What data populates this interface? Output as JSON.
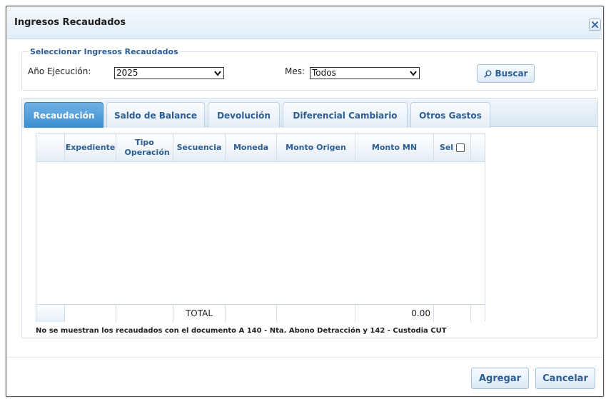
{
  "dialog": {
    "title": "Ingresos Recaudados",
    "close_icon": "close-icon"
  },
  "filter": {
    "legend": "Seleccionar Ingresos Recaudados",
    "year_label": "Año Ejecución:",
    "year_value": "2025",
    "month_label": "Mes:",
    "month_value": "Todos",
    "search_label": "Buscar",
    "search_icon": "search-icon"
  },
  "tabs": [
    {
      "label": "Recaudación",
      "active": true
    },
    {
      "label": "Saldo de Balance",
      "active": false
    },
    {
      "label": "Devolución",
      "active": false
    },
    {
      "label": "Diferencial Cambiario",
      "active": false
    },
    {
      "label": "Otros Gastos",
      "active": false
    }
  ],
  "grid": {
    "columns": [
      {
        "label": ""
      },
      {
        "label": "Expediente"
      },
      {
        "label": "Tipo Operación"
      },
      {
        "label": "Secuencia"
      },
      {
        "label": "Moneda"
      },
      {
        "label": "Monto Origen"
      },
      {
        "label": "Monto MN"
      },
      {
        "label": "Sel"
      },
      {
        "label": ""
      }
    ],
    "rows": [],
    "footer": {
      "total_label": "TOTAL",
      "total_mn": "0.00"
    }
  },
  "note": "No se muestran los recaudados con el documento A 140 - Nta. Abono Detracción y 142 - Custodia CUT",
  "actions": {
    "add_label": "Agregar",
    "cancel_label": "Cancelar"
  },
  "colors": {
    "accent": "#2c5d94",
    "active_tab": "#3c8fd3",
    "header_bg": "#e2edf6"
  }
}
